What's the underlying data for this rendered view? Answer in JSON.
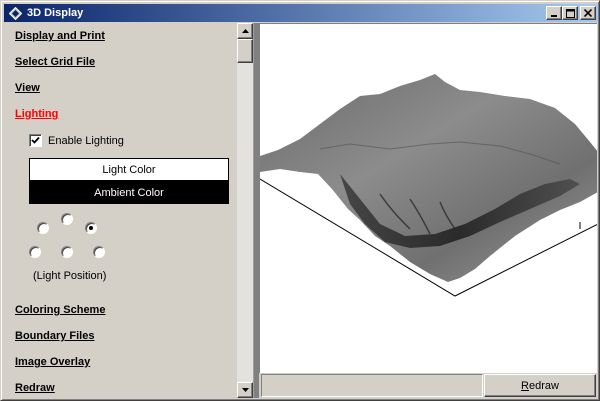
{
  "window": {
    "title": "3D Display",
    "app_icon": "diamond-app-icon"
  },
  "title_buttons": {
    "minimize": "minimize-icon",
    "maximize": "maximize-icon",
    "close": "close-icon"
  },
  "sidebar": {
    "sections": [
      {
        "label": "Display and Print"
      },
      {
        "label": "Select Grid File"
      },
      {
        "label": "View"
      },
      {
        "label": "Lighting",
        "active": true
      }
    ],
    "lighting": {
      "enable_lighting_label": "Enable Lighting",
      "enable_lighting_checked": true,
      "light_color_label": "Light Color",
      "ambient_color_label": "Ambient Color",
      "light_color": "#ffffff",
      "ambient_color": "#000000",
      "light_position_label": "(Light Position)",
      "light_position_selected": 2
    },
    "bottom_sections": [
      {
        "label": "Coloring Scheme"
      },
      {
        "label": "Boundary Files"
      },
      {
        "label": "Image Overlay"
      },
      {
        "label": "Redraw"
      }
    ],
    "active_color": "#ff0000"
  },
  "footer": {
    "redraw_first_letter": "R",
    "redraw_rest": "edraw"
  }
}
